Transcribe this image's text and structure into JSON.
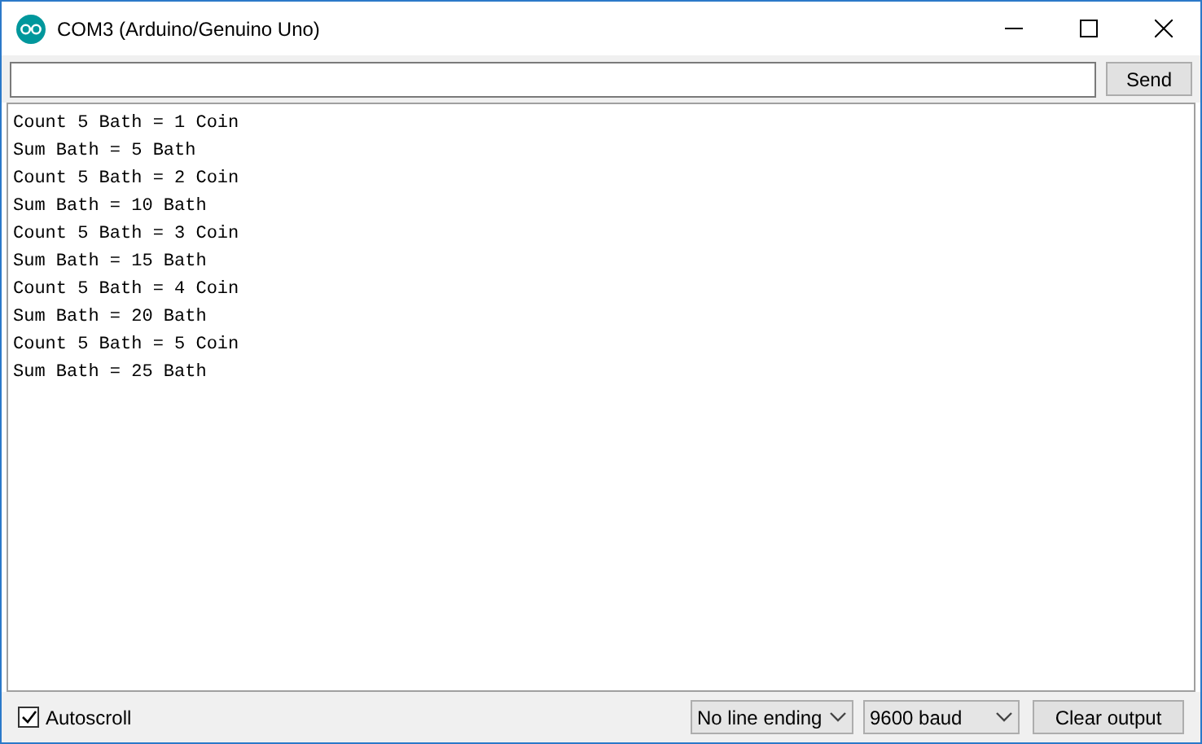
{
  "window": {
    "title": "COM3 (Arduino/Genuino Uno)"
  },
  "send_button": "Send",
  "output_lines": [
    "Count 5 Bath = 1 Coin",
    "Sum Bath = 5 Bath",
    "Count 5 Bath = 2 Coin",
    "Sum Bath = 10 Bath",
    "Count 5 Bath = 3 Coin",
    "Sum Bath = 15 Bath",
    "Count 5 Bath = 4 Coin",
    "Sum Bath = 20 Bath",
    "Count 5 Bath = 5 Coin",
    "Sum Bath = 25 Bath"
  ],
  "status_bar": {
    "autoscroll": {
      "label": "Autoscroll",
      "checked": true
    },
    "line_ending": "No line ending",
    "baud": "9600 baud",
    "clear_button": "Clear output"
  }
}
